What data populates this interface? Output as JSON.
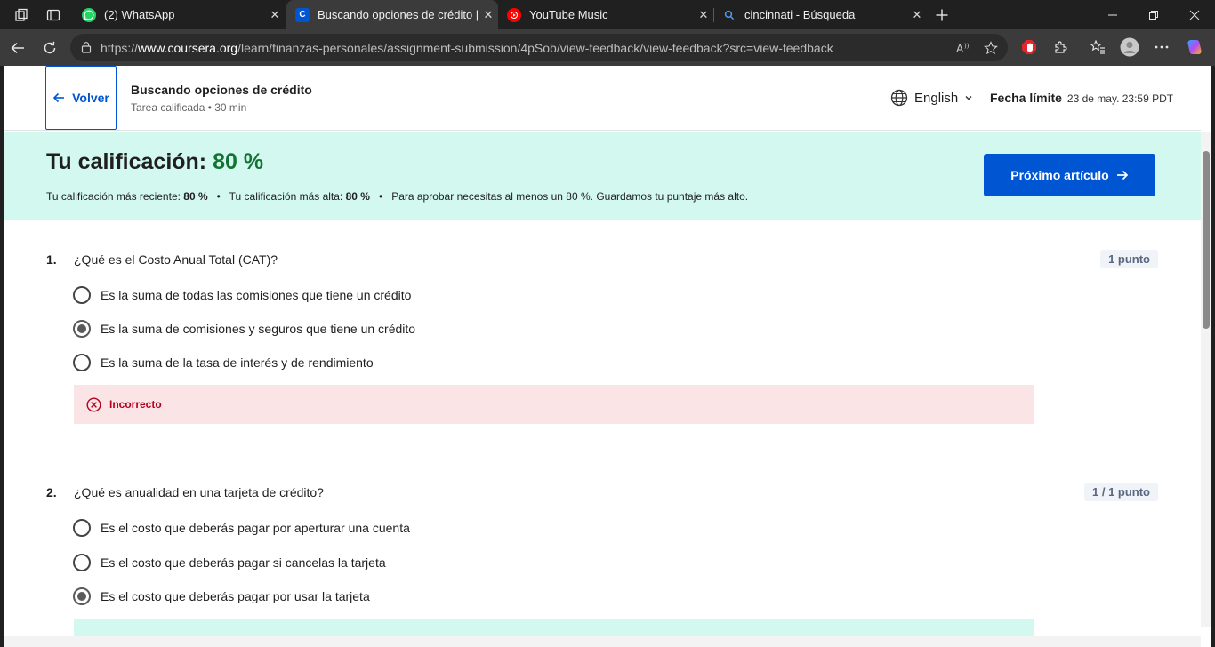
{
  "browser": {
    "tabs": [
      {
        "title": "(2) WhatsApp",
        "icon": "whatsapp-icon",
        "color": "#25d366"
      },
      {
        "title": "Buscando opciones de crédito | C",
        "icon": "coursera-icon",
        "color": "#0056d2",
        "active": true
      },
      {
        "title": "YouTube Music",
        "icon": "youtube-music-icon",
        "color": "#ff0000"
      },
      {
        "title": "cincinnati - Búsqueda",
        "icon": "search-icon",
        "color": "#3b82f6"
      }
    ],
    "url_prefix": "https://",
    "url_domain": "www.coursera.org",
    "url_path": "/learn/finanzas-personales/assignment-submission/4pSob/view-feedback/view-feedback?src=view-feedback"
  },
  "header": {
    "back_label": "Volver",
    "title": "Buscando opciones de crédito",
    "subtitle": "Tarea calificada • 30 min",
    "language": "English",
    "deadline_label": "Fecha límite",
    "deadline_value": "23 de may. 23:59 PDT"
  },
  "grade": {
    "title_label": "Tu calificación:",
    "title_value": "80 %",
    "recent_label": "Tu calificación más reciente:",
    "recent_value": "80 %",
    "highest_label": "Tu calificación más alta:",
    "highest_value": "80 %",
    "pass_note": "Para aprobar necesitas al menos un 80 %. Guardamos tu puntaje más alto.",
    "next_button": "Próximo artículo"
  },
  "questions": [
    {
      "number": "1.",
      "text": "¿Qué es el Costo Anual Total (CAT)?",
      "points": "1 punto",
      "options": [
        {
          "label": "Es la suma de todas las comisiones que tiene un crédito",
          "selected": false
        },
        {
          "label": "Es la suma de comisiones y seguros  que tiene un crédito",
          "selected": true
        },
        {
          "label": "Es la suma de la tasa de interés y de rendimiento",
          "selected": false
        }
      ],
      "feedback": "Incorrecto"
    },
    {
      "number": "2.",
      "text": "¿Qué es anualidad en una tarjeta de crédito?",
      "points": "1 / 1 punto",
      "options": [
        {
          "label": "Es el costo que deberás pagar por aperturar una cuenta",
          "selected": false
        },
        {
          "label": "Es el costo que deberás pagar si cancelas la tarjeta",
          "selected": false
        },
        {
          "label": "Es el costo que deberás pagar por usar la tarjeta",
          "selected": true
        }
      ]
    }
  ]
}
